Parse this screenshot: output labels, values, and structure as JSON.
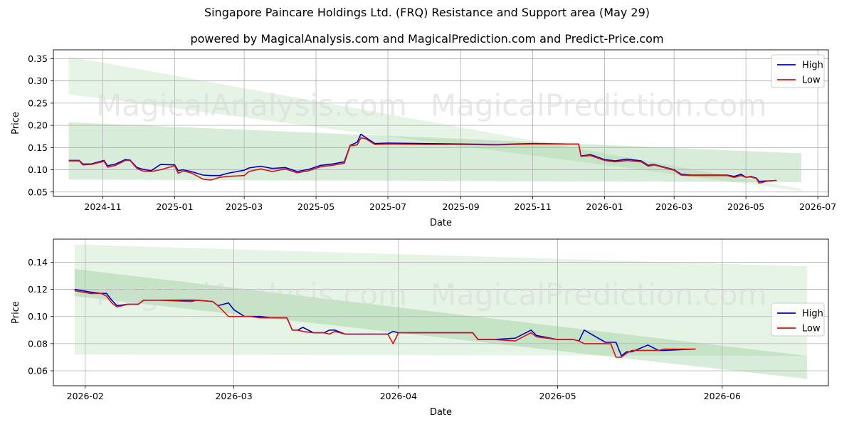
{
  "title": "Singapore Paincare Holdings Ltd. (FRQ) Resistance and Support area (May 29)",
  "subtitle": "powered by MagicalAnalysis.com and MagicalPrediction.com and Predict-Price.com",
  "watermarks": [
    "MagicalAnalysis.com",
    "MagicalPrediction.com"
  ],
  "colors": {
    "high": "#0000cc",
    "low": "#dd1111",
    "band": "#4caf50",
    "grid": "#b0b0b0"
  },
  "chart_data": [
    {
      "type": "line",
      "xlabel": "Date",
      "ylabel": "Price",
      "xlim": [
        "2024-09-20",
        "2026-07-10"
      ],
      "ylim": [
        0.04,
        0.37
      ],
      "xticks": [
        "2024-11-01",
        "2025-01-01",
        "2025-03-01",
        "2025-05-01",
        "2025-07-01",
        "2025-09-01",
        "2025-11-01",
        "2026-01-01",
        "2026-03-01",
        "2026-05-01",
        "2026-07-01"
      ],
      "xtick_labels": [
        "2024-11",
        "2025-01",
        "2025-03",
        "2025-05",
        "2025-07",
        "2025-09",
        "2025-11",
        "2026-01",
        "2026-03",
        "2026-05",
        "2026-07"
      ],
      "yticks": [
        0.05,
        0.1,
        0.15,
        0.2,
        0.25,
        0.3,
        0.35
      ],
      "ytick_labels": [
        "0.05",
        "0.10",
        "0.15",
        "0.20",
        "0.25",
        "0.30",
        "0.35"
      ],
      "grid": true,
      "legend": "top-right",
      "bands": [
        {
          "x": [
            "2024-10-03",
            "2026-06-17"
          ],
          "upper": [
            0.355,
            0.057
          ],
          "lower": [
            0.27,
            0.052
          ]
        },
        {
          "x": [
            "2024-10-03",
            "2026-06-17"
          ],
          "upper": [
            0.207,
            0.137
          ],
          "lower": [
            0.078,
            0.072
          ]
        }
      ],
      "series": [
        {
          "name": "High",
          "x": [
            "2024-10-03",
            "2024-10-12",
            "2024-10-15",
            "2024-10-22",
            "2024-11-02",
            "2024-11-05",
            "2024-11-12",
            "2024-11-20",
            "2024-11-24",
            "2024-11-30",
            "2024-12-05",
            "2024-12-12",
            "2024-12-20",
            "2025-01-01",
            "2025-01-04",
            "2025-01-08",
            "2025-01-15",
            "2025-01-25",
            "2025-02-01",
            "2025-02-08",
            "2025-02-15",
            "2025-03-01",
            "2025-03-05",
            "2025-03-15",
            "2025-03-25",
            "2025-04-05",
            "2025-04-15",
            "2025-04-25",
            "2025-05-05",
            "2025-05-15",
            "2025-05-25",
            "2025-05-30",
            "2025-06-05",
            "2025-06-08",
            "2025-06-12",
            "2025-06-20",
            "2025-07-01",
            "2025-08-01",
            "2025-09-01",
            "2025-10-01",
            "2025-11-01",
            "2025-12-01",
            "2025-12-10",
            "2025-12-12",
            "2025-12-20",
            "2026-01-01",
            "2026-01-10",
            "2026-01-20",
            "2026-02-01",
            "2026-02-07",
            "2026-02-12",
            "2026-03-01",
            "2026-03-07",
            "2026-03-15",
            "2026-04-01",
            "2026-04-15",
            "2026-04-21",
            "2026-04-27",
            "2026-05-01",
            "2026-05-05",
            "2026-05-10",
            "2026-05-12",
            "2026-05-20",
            "2026-05-27"
          ],
          "y": [
            0.121,
            0.121,
            0.113,
            0.113,
            0.121,
            0.109,
            0.113,
            0.123,
            0.122,
            0.105,
            0.101,
            0.098,
            0.112,
            0.111,
            0.098,
            0.1,
            0.096,
            0.088,
            0.087,
            0.087,
            0.092,
            0.099,
            0.104,
            0.108,
            0.103,
            0.105,
            0.096,
            0.101,
            0.11,
            0.113,
            0.118,
            0.155,
            0.162,
            0.18,
            0.173,
            0.159,
            0.16,
            0.159,
            0.158,
            0.157,
            0.159,
            0.158,
            0.158,
            0.131,
            0.134,
            0.123,
            0.12,
            0.124,
            0.12,
            0.11,
            0.112,
            0.1,
            0.09,
            0.088,
            0.088,
            0.088,
            0.085,
            0.09,
            0.083,
            0.085,
            0.081,
            0.074,
            0.075,
            0.076
          ]
        },
        {
          "name": "Low",
          "x": [
            "2024-10-03",
            "2024-10-12",
            "2024-10-15",
            "2024-10-22",
            "2024-11-02",
            "2024-11-05",
            "2024-11-12",
            "2024-11-20",
            "2024-11-24",
            "2024-11-30",
            "2024-12-05",
            "2024-12-12",
            "2024-12-20",
            "2025-01-01",
            "2025-01-04",
            "2025-01-08",
            "2025-01-15",
            "2025-01-25",
            "2025-02-01",
            "2025-02-08",
            "2025-02-15",
            "2025-03-01",
            "2025-03-05",
            "2025-03-15",
            "2025-03-25",
            "2025-04-05",
            "2025-04-15",
            "2025-04-25",
            "2025-05-05",
            "2025-05-15",
            "2025-05-25",
            "2025-05-30",
            "2025-06-05",
            "2025-06-08",
            "2025-06-12",
            "2025-06-20",
            "2025-07-01",
            "2025-08-01",
            "2025-09-01",
            "2025-10-01",
            "2025-11-01",
            "2025-12-01",
            "2025-12-10",
            "2025-12-12",
            "2025-12-20",
            "2026-01-01",
            "2026-01-10",
            "2026-01-20",
            "2026-02-01",
            "2026-02-07",
            "2026-02-12",
            "2026-03-01",
            "2026-03-07",
            "2026-03-15",
            "2026-04-01",
            "2026-04-15",
            "2026-04-21",
            "2026-04-27",
            "2026-05-01",
            "2026-05-05",
            "2026-05-10",
            "2026-05-12",
            "2026-05-20",
            "2026-05-27"
          ],
          "y": [
            0.12,
            0.12,
            0.111,
            0.112,
            0.119,
            0.106,
            0.11,
            0.121,
            0.121,
            0.103,
            0.097,
            0.096,
            0.1,
            0.109,
            0.092,
            0.097,
            0.093,
            0.079,
            0.077,
            0.083,
            0.085,
            0.087,
            0.096,
            0.102,
            0.096,
            0.102,
            0.093,
            0.098,
            0.107,
            0.11,
            0.115,
            0.154,
            0.156,
            0.172,
            0.17,
            0.157,
            0.158,
            0.157,
            0.157,
            0.156,
            0.158,
            0.158,
            0.158,
            0.13,
            0.132,
            0.121,
            0.118,
            0.121,
            0.118,
            0.108,
            0.111,
            0.099,
            0.088,
            0.087,
            0.087,
            0.087,
            0.083,
            0.087,
            0.083,
            0.084,
            0.08,
            0.07,
            0.075,
            0.076
          ]
        }
      ]
    },
    {
      "type": "line",
      "xlabel": "Date",
      "ylabel": "Price",
      "xlim": [
        "2026-01-26",
        "2026-06-21"
      ],
      "ylim": [
        0.049,
        0.157
      ],
      "xticks": [
        "2026-02-01",
        "2026-03-01",
        "2026-04-01",
        "2026-05-01",
        "2026-06-01"
      ],
      "xtick_labels": [
        "2026-02",
        "2026-03",
        "2026-04",
        "2026-05",
        "2026-06"
      ],
      "yticks": [
        0.06,
        0.08,
        0.1,
        0.12,
        0.14
      ],
      "ytick_labels": [
        "0.06",
        "0.08",
        "0.10",
        "0.12",
        "0.14"
      ],
      "grid": true,
      "legend": "center-right",
      "bands": [
        {
          "x": [
            "2026-01-30",
            "2026-06-17"
          ],
          "upper": [
            0.153,
            0.137
          ],
          "lower": [
            0.072,
            0.071
          ]
        },
        {
          "x": [
            "2026-01-30",
            "2026-06-17"
          ],
          "upper": [
            0.135,
            0.071
          ],
          "lower": [
            0.115,
            0.054
          ]
        }
      ],
      "series": [
        {
          "name": "High",
          "x": [
            "2026-01-30",
            "2026-02-02",
            "2026-02-04",
            "2026-02-05",
            "2026-02-06",
            "2026-02-07",
            "2026-02-09",
            "2026-02-11",
            "2026-02-12",
            "2026-02-15",
            "2026-02-21",
            "2026-02-22",
            "2026-02-25",
            "2026-02-26",
            "2026-02-28",
            "2026-03-01",
            "2026-03-03",
            "2026-03-04",
            "2026-03-06",
            "2026-03-08",
            "2026-03-09",
            "2026-03-10",
            "2026-03-11",
            "2026-03-12",
            "2026-03-13",
            "2026-03-14",
            "2026-03-16",
            "2026-03-17",
            "2026-03-18",
            "2026-03-19",
            "2026-03-20",
            "2026-03-22",
            "2026-03-29",
            "2026-03-30",
            "2026-03-31",
            "2026-04-01",
            "2026-04-14",
            "2026-04-15",
            "2026-04-16",
            "2026-04-18",
            "2026-04-19",
            "2026-04-23",
            "2026-04-26",
            "2026-04-27",
            "2026-05-01",
            "2026-05-02",
            "2026-05-04",
            "2026-05-05",
            "2026-05-06",
            "2026-05-10",
            "2026-05-11",
            "2026-05-12",
            "2026-05-13",
            "2026-05-14",
            "2026-05-15",
            "2026-05-18",
            "2026-05-20",
            "2026-05-21",
            "2026-05-27"
          ],
          "y": [
            0.12,
            0.118,
            0.117,
            0.117,
            0.112,
            0.108,
            0.109,
            0.109,
            0.112,
            0.112,
            0.112,
            0.112,
            0.111,
            0.108,
            0.11,
            0.105,
            0.1,
            0.1,
            0.1,
            0.099,
            0.099,
            0.099,
            0.099,
            0.09,
            0.09,
            0.092,
            0.088,
            0.088,
            0.088,
            0.09,
            0.09,
            0.087,
            0.087,
            0.087,
            0.089,
            0.088,
            0.088,
            0.088,
            0.083,
            0.083,
            0.083,
            0.084,
            0.09,
            0.086,
            0.083,
            0.083,
            0.083,
            0.082,
            0.09,
            0.081,
            0.081,
            0.081,
            0.071,
            0.074,
            0.074,
            0.079,
            0.075,
            0.075,
            0.076
          ]
        },
        {
          "name": "Low",
          "x": [
            "2026-01-30",
            "2026-02-02",
            "2026-02-04",
            "2026-02-05",
            "2026-02-06",
            "2026-02-07",
            "2026-02-09",
            "2026-02-11",
            "2026-02-12",
            "2026-02-15",
            "2026-02-21",
            "2026-02-22",
            "2026-02-25",
            "2026-02-26",
            "2026-02-28",
            "2026-03-01",
            "2026-03-03",
            "2026-03-04",
            "2026-03-06",
            "2026-03-08",
            "2026-03-09",
            "2026-03-10",
            "2026-03-11",
            "2026-03-12",
            "2026-03-13",
            "2026-03-14",
            "2026-03-16",
            "2026-03-17",
            "2026-03-18",
            "2026-03-19",
            "2026-03-20",
            "2026-03-22",
            "2026-03-29",
            "2026-03-30",
            "2026-03-31",
            "2026-04-01",
            "2026-04-14",
            "2026-04-15",
            "2026-04-16",
            "2026-04-18",
            "2026-04-19",
            "2026-04-23",
            "2026-04-26",
            "2026-04-27",
            "2026-05-01",
            "2026-05-02",
            "2026-05-04",
            "2026-05-05",
            "2026-05-06",
            "2026-05-10",
            "2026-05-11",
            "2026-05-12",
            "2026-05-13",
            "2026-05-14",
            "2026-05-15",
            "2026-05-18",
            "2026-05-20",
            "2026-05-21",
            "2026-05-27"
          ],
          "y": [
            0.119,
            0.117,
            0.117,
            0.115,
            0.11,
            0.107,
            0.109,
            0.109,
            0.112,
            0.112,
            0.111,
            0.112,
            0.111,
            0.108,
            0.1,
            0.1,
            0.1,
            0.1,
            0.099,
            0.099,
            0.099,
            0.099,
            0.099,
            0.09,
            0.09,
            0.089,
            0.088,
            0.088,
            0.088,
            0.087,
            0.089,
            0.087,
            0.087,
            0.087,
            0.08,
            0.088,
            0.088,
            0.088,
            0.083,
            0.083,
            0.083,
            0.082,
            0.088,
            0.085,
            0.083,
            0.083,
            0.083,
            0.082,
            0.08,
            0.08,
            0.08,
            0.07,
            0.07,
            0.073,
            0.075,
            0.075,
            0.075,
            0.076,
            0.076
          ]
        }
      ]
    }
  ]
}
